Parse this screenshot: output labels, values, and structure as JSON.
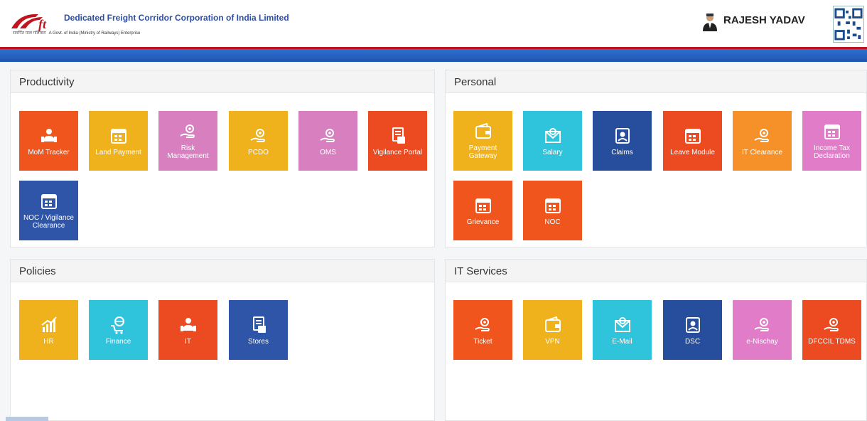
{
  "header": {
    "org_name": "Dedicated Freight Corridor Corporation of India Limited",
    "org_hindi": "समर्पित माल गलियारा",
    "org_sub": "A Govt. of India (Ministry of Railways) Enterprise",
    "user_name": "RAJESH YADAV"
  },
  "sections": {
    "productivity": {
      "title": "Productivity",
      "tiles": [
        "MoM Tracker",
        "Land Payment",
        "Risk Management",
        "PCDO",
        "OMS",
        "Vigilance Portal",
        "NOC / Vigilance Clearance"
      ]
    },
    "personal": {
      "title": "Personal",
      "tiles": [
        "Payment Gateway",
        "Salary",
        "Claims",
        "Leave Module",
        "IT Clearance",
        "Income Tax Declaration",
        "Grievance",
        "NOC"
      ]
    },
    "policies": {
      "title": "Policies",
      "tiles": [
        "HR",
        "Finance",
        "IT",
        "Stores"
      ]
    },
    "it_services": {
      "title": "IT Services",
      "tiles": [
        "Ticket",
        "VPN",
        "E-Mail",
        "DSC",
        "e-Nischay",
        "DFCCIL TDMS"
      ]
    }
  },
  "colors": {
    "brand_red": "#c0141e",
    "brand_blue": "#2f6fd0",
    "tile_orange": "#f0551e",
    "tile_yellow": "#f0b21c",
    "tile_pink": "#d87fc0",
    "tile_navy": "#2f55a8",
    "tile_cyan": "#2fc4dc"
  }
}
